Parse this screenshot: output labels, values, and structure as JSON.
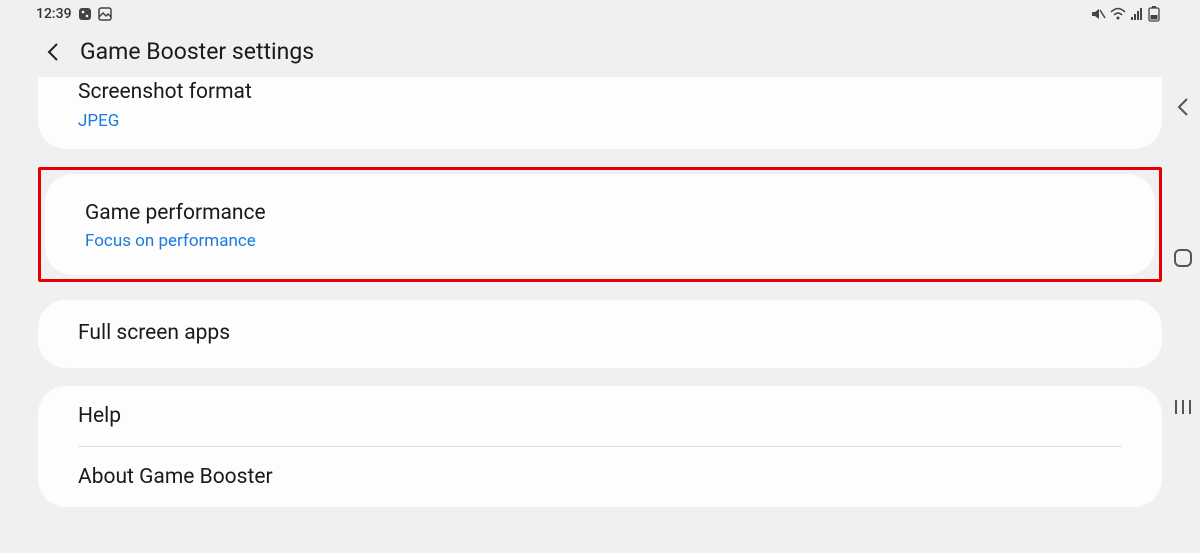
{
  "status": {
    "time": "12:39",
    "icons": {
      "dice": "dice-icon",
      "gallery": "gallery-icon",
      "mute": "mute-icon",
      "wifi": "wifi-icon",
      "signal": "signal-icon",
      "battery": "battery-icon"
    }
  },
  "header": {
    "title": "Game Booster settings"
  },
  "items": {
    "screenshot": {
      "title": "Screenshot format",
      "value": "JPEG"
    },
    "performance": {
      "title": "Game performance",
      "value": "Focus on performance"
    },
    "fullscreen": {
      "title": "Full screen apps"
    },
    "help": {
      "title": "Help"
    },
    "about": {
      "title": "About Game Booster"
    }
  }
}
